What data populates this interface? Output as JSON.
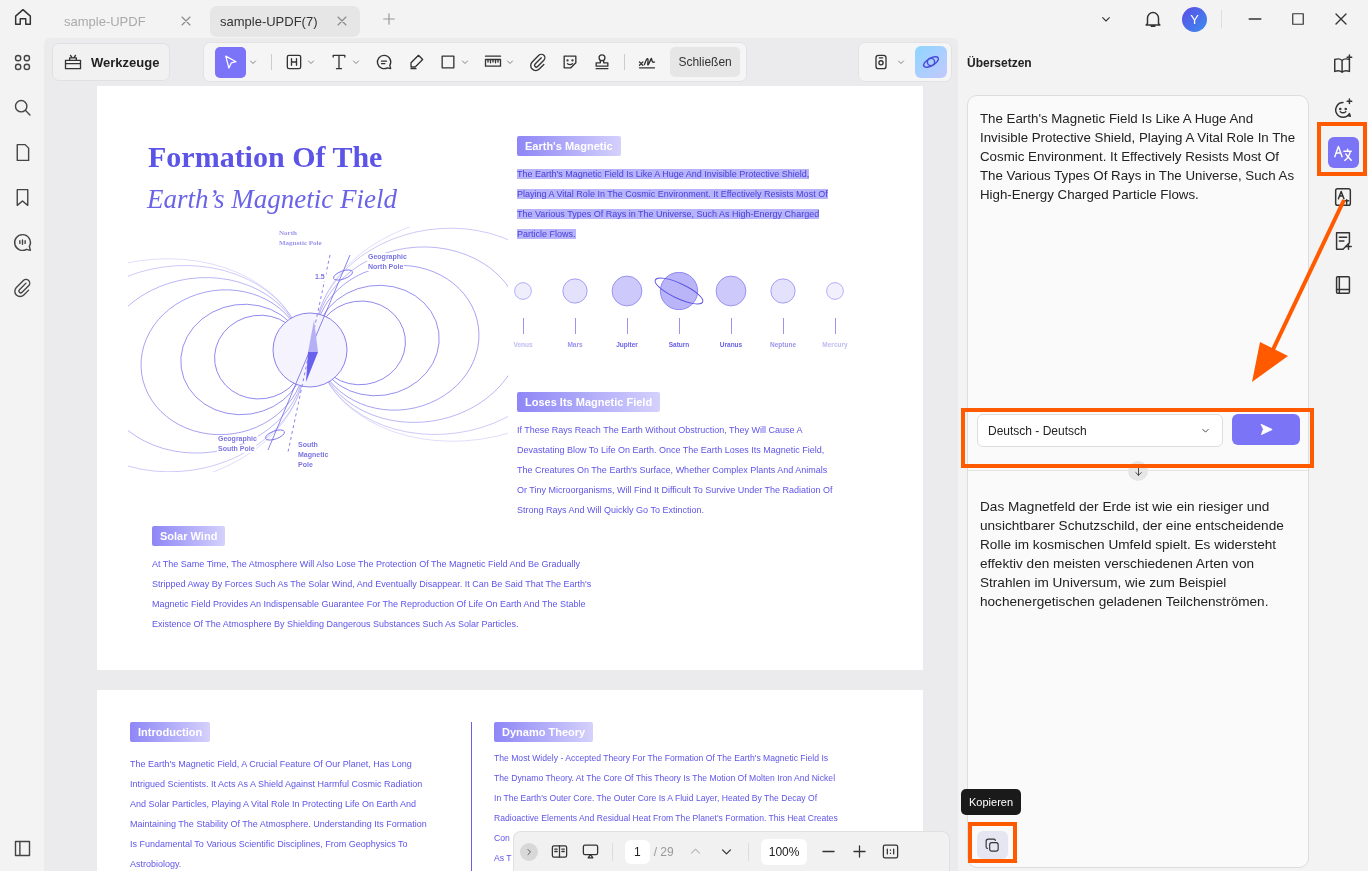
{
  "tabs": [
    {
      "label": "sample-UPDF",
      "selected": false
    },
    {
      "label": "sample-UPDF(7)",
      "selected": true
    }
  ],
  "account": {
    "avatar": "Y"
  },
  "left_rail": [
    {
      "kind": "apps"
    },
    {
      "kind": "search"
    },
    {
      "kind": "pages"
    },
    {
      "kind": "bookmark"
    },
    {
      "kind": "comments"
    },
    {
      "kind": "attachment"
    }
  ],
  "toolbar": {
    "tools_button": "Werkzeuge",
    "close_button": "Schließen",
    "tools": [
      {
        "kind": "select",
        "selected": true,
        "dropdown": true
      },
      {
        "kind": "heading",
        "selected": false,
        "dropdown": true
      },
      {
        "kind": "text",
        "selected": false,
        "dropdown": true
      },
      {
        "kind": "comment",
        "selected": false,
        "dropdown": false
      },
      {
        "kind": "pen",
        "selected": false,
        "dropdown": false
      },
      {
        "kind": "rectangle",
        "selected": false,
        "dropdown": true
      },
      {
        "kind": "ruler",
        "selected": false,
        "dropdown": true
      },
      {
        "kind": "attachment",
        "selected": false,
        "dropdown": false
      },
      {
        "kind": "sticker",
        "selected": false,
        "dropdown": false
      },
      {
        "kind": "stamp",
        "selected": false,
        "dropdown": false
      },
      {
        "kind": "signature",
        "selected": false,
        "dropdown": false
      }
    ]
  },
  "page1": {
    "title_line_1": "Formation Of The",
    "title_line_2": "Earth’s Magnetic Field",
    "diagram_labels": [
      {
        "text": "North",
        "kind": "serif"
      },
      {
        "text": "Magnetic Pole",
        "kind": "serif"
      },
      {
        "text": "1.5",
        "kind": "sans"
      },
      {
        "text": "Geographic",
        "kind": "sans"
      },
      {
        "text": "North Pole",
        "kind": "sans"
      },
      {
        "text": "Geographic",
        "kind": "sans"
      },
      {
        "text": "South Pole",
        "kind": "sans"
      },
      {
        "text": "South",
        "kind": "sans"
      },
      {
        "text": "Magnetic",
        "kind": "sans"
      },
      {
        "text": "Pole",
        "kind": "sans"
      }
    ],
    "sections": [
      {
        "heading": "Earth's Magnetic",
        "text": "The Earth's Magnetic Field Is Like A Huge And Invisible Protective Shield, Playing A Vital Role In The Cosmic Environment. It Effectively Resists Most Of The Various Types Of Rays in The Universe, Such As High-Energy Charged Particle Flows.",
        "selected": true
      },
      {
        "heading": "Loses Its Magnetic Field",
        "text": "If These Rays Reach The Earth Without Obstruction, They Will Cause A Devastating Blow To Life On Earth. Once The Earth Loses Its Magnetic Field, The Creatures On The Earth's Surface, Whether Complex Plants And Animals Or Tiny Microorganisms, Will Find It Difficult To Survive Under The Radiation Of Strong Rays And Will Quickly Go To Extinction.",
        "selected": false
      },
      {
        "heading": "Solar Wind",
        "text": "At The Same Time, The Atmosphere Will Also Lose The Protection Of The Magnetic Field And Be Gradually Stripped Away By Forces Such As The Solar Wind, And Eventually Disappear. It Can Be Said That The Earth's Magnetic Field Provides An Indispensable Guarantee For The Reproduction Of Life On Earth And The Stable Existence Of The Atmosphere By Shielding Dangerous Substances Such As Solar Particles.",
        "selected": false
      }
    ],
    "planets": [
      {
        "name": "Venus",
        "kind": "plain",
        "color": "#efeefc"
      },
      {
        "name": "Mars",
        "kind": "plain",
        "color": "#e3e1fb"
      },
      {
        "name": "Jupiter",
        "kind": "plain",
        "color": "#cdc9fa"
      },
      {
        "name": "Saturn",
        "kind": "ringed",
        "color": "#bab5f8"
      },
      {
        "name": "Uranus",
        "kind": "plain",
        "color": "#cdc9fa"
      },
      {
        "name": "Neptune",
        "kind": "plain",
        "color": "#e3e1fb"
      },
      {
        "name": "Mercury",
        "kind": "plain",
        "color": "#f1f0fc"
      }
    ]
  },
  "page2": {
    "intro": {
      "heading": "Introduction",
      "text": "The Earth's Magnetic Field, A Crucial Feature Of Our Planet, Has Long Intrigued Scientists. It Acts As A Shield Against Harmful Cosmic Radiation And Solar Particles, Playing A Vital Role In Protecting Life On Earth And Maintaining The Stability Of The Atmosphere. Understanding Its Formation Is Fundamental To Various Scientific Disciplines, From Geophysics To Astrobiology."
    },
    "dynamo": {
      "heading": "Dynamo Theory",
      "lines": [
        "The Most Widely - Accepted Theory For The Formation Of The Earth's Magnetic Field Is",
        "The Dynamo Theory. At The Core Of This Theory Is The Motion Of Molten Iron And Nickel",
        "In The Earth's Outer Core. The Outer Core Is A Fluid Layer, Heated By The Decay Of",
        "Radioactive Elements And Residual Heat From The Planet's Formation. This Heat Creates",
        "Con",
        "As T"
      ]
    }
  },
  "page_nav": {
    "page": "1",
    "total": "/ 29",
    "zoom": "100%"
  },
  "panel": {
    "title": "Übersetzen",
    "source": "The Earth's Magnetic Field Is Like A Huge And Invisible Protective Shield, Playing A Vital Role In The Cosmic Environment. It Effectively Resists Most Of The Various Types Of Rays in The Universe, Such As High-Energy Charged Particle Flows.",
    "language": "Deutsch - Deutsch",
    "translation": "Das Magnetfeld der Erde ist wie ein riesiger und unsichtbarer Schutzschild, der eine entscheidende Rolle im kosmischen Umfeld spielt. Es widersteht effektiv den meisten verschiedenen Arten von Strahlen im Universum, wie zum Beispiel hochenergetischen geladenen Teilchenströmen.",
    "tooltip": "Kopieren"
  },
  "right_rail": [
    {
      "kind": "book-sparkle",
      "selected": false
    },
    {
      "kind": "chat-bot",
      "selected": false
    },
    {
      "kind": "translate",
      "selected": true
    },
    {
      "kind": "translate-doc",
      "selected": false
    },
    {
      "kind": "summary",
      "selected": false
    },
    {
      "kind": "book",
      "selected": false
    }
  ]
}
